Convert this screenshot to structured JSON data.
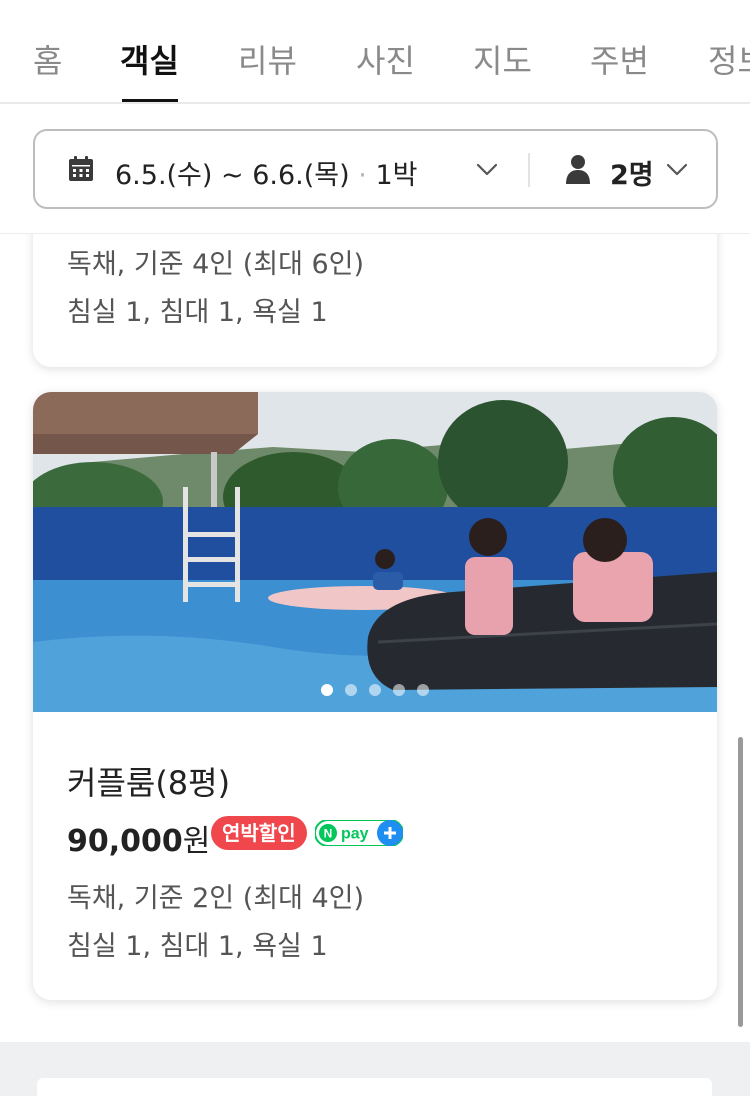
{
  "tabs": [
    {
      "label": "홈",
      "active": false
    },
    {
      "label": "객실",
      "active": true
    },
    {
      "label": "리뷰",
      "active": false
    },
    {
      "label": "사진",
      "active": false
    },
    {
      "label": "지도",
      "active": false
    },
    {
      "label": "주변",
      "active": false
    },
    {
      "label": "정보",
      "active": false
    }
  ],
  "date_selector": {
    "dates": "6.5.(수) ~ 6.6.(목)",
    "separator": "·",
    "nights": "1박",
    "guests": "2명",
    "calendar_icon": "calendar-icon",
    "person_icon": "person-icon"
  },
  "previous_room": {
    "type_capacity": "독채, 기준 4인 (최대 6인)",
    "rooms": "침실 1, 침대 1, 욕실 1"
  },
  "room": {
    "name": "커플룸(8평)",
    "price_amount": "90,000",
    "price_unit": "원",
    "discount_badge": "연박할인",
    "npay_badge": "Npay+",
    "type_capacity": "독채, 기준 2인 (최대 4인)",
    "rooms": "침실 1, 침대 1, 욕실 1",
    "photo_count": 5,
    "photo_index": 1
  },
  "colors": {
    "discount": "#f0474d",
    "npay_green": "#03c75a",
    "npay_blue": "#1e8ef0",
    "active_tab": "#111111"
  }
}
